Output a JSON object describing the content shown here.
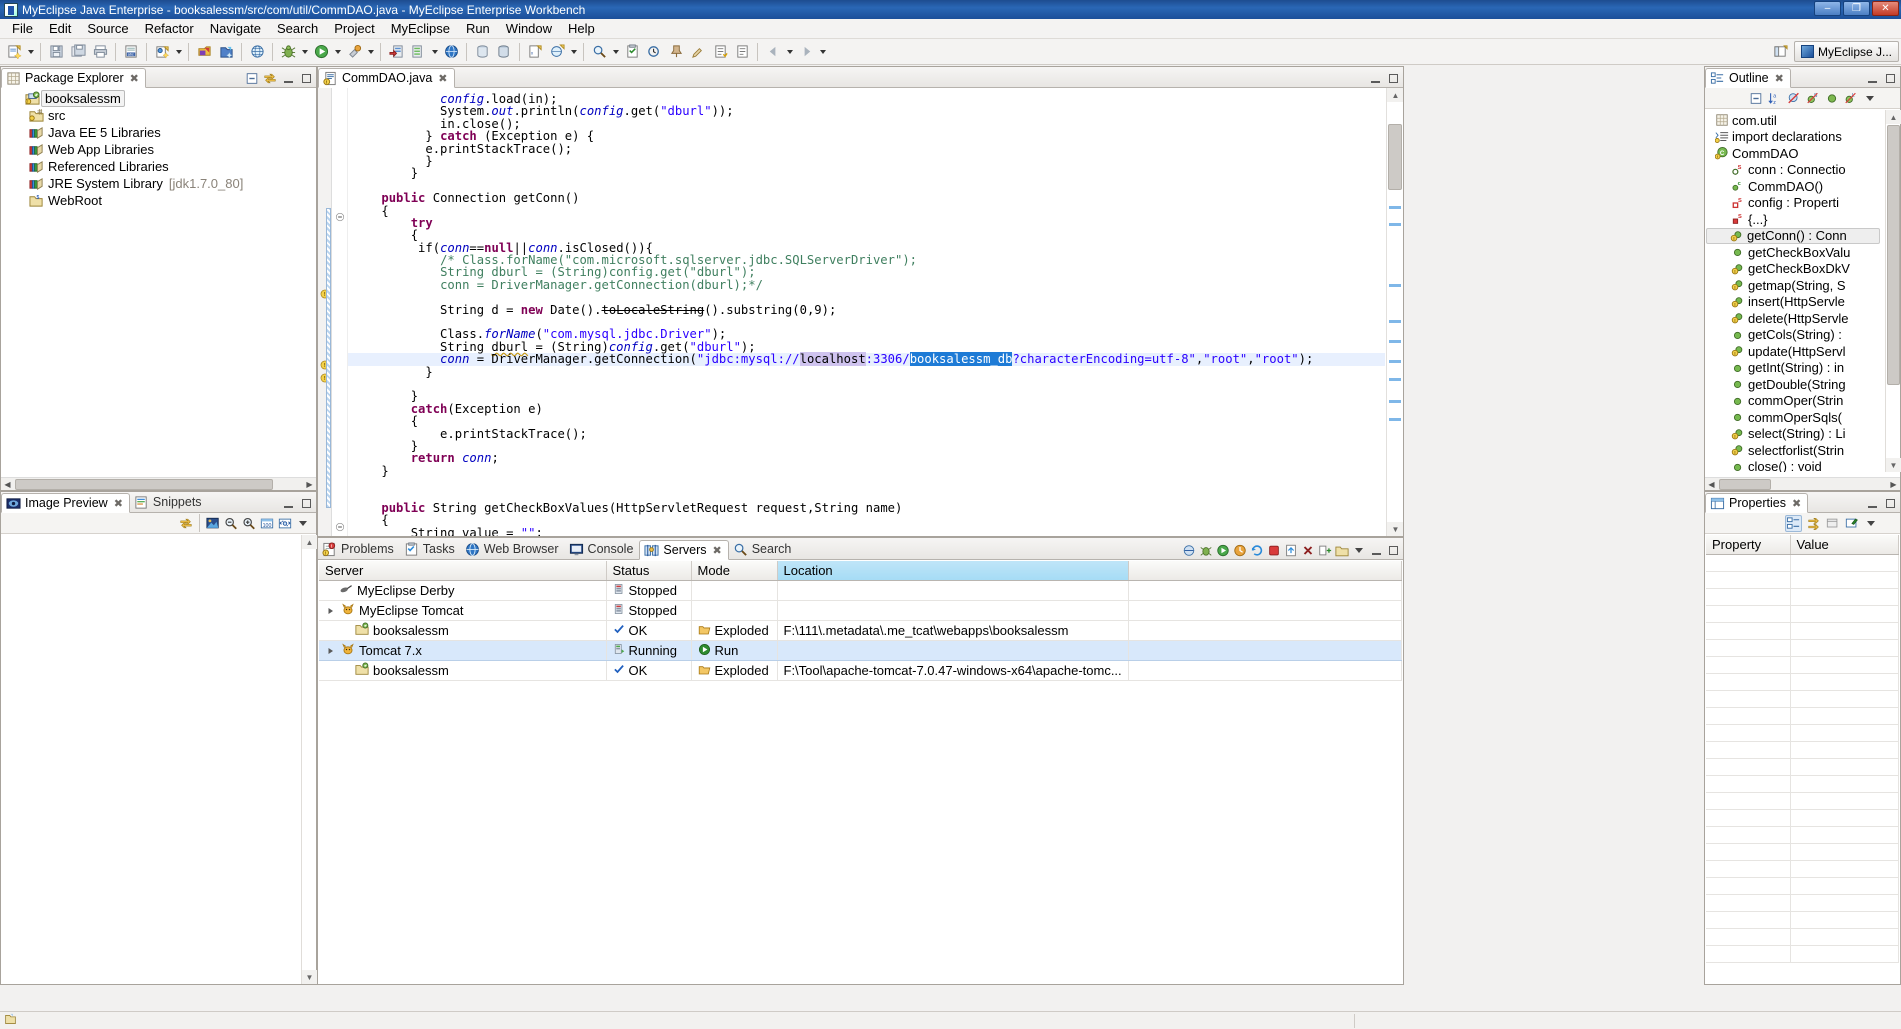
{
  "window": {
    "title": "MyEclipse Java Enterprise - booksalessm/src/com/util/CommDAO.java - MyEclipse Enterprise Workbench",
    "buttons": {
      "minimize": "–",
      "maximize": "❐",
      "close": "✕"
    }
  },
  "menubar": [
    "File",
    "Edit",
    "Source",
    "Refactor",
    "Navigate",
    "Search",
    "Project",
    "MyEclipse",
    "Run",
    "Window",
    "Help"
  ],
  "perspective": {
    "label": "MyEclipse J..."
  },
  "package_explorer": {
    "tab": "Package Explorer",
    "tree": [
      {
        "label": "booksalessm",
        "indent": 0,
        "icon": "project-icon",
        "selected": true
      },
      {
        "label": "src",
        "indent": 1,
        "icon": "source-folder-icon",
        "selected": false
      },
      {
        "label": "Java EE 5 Libraries",
        "indent": 1,
        "icon": "library-icon",
        "selected": false
      },
      {
        "label": "Web App Libraries",
        "indent": 1,
        "icon": "library-icon",
        "selected": false
      },
      {
        "label": "Referenced Libraries",
        "indent": 1,
        "icon": "library-icon",
        "selected": false
      },
      {
        "label": "JRE System Library",
        "suffix": "[jdk1.7.0_80]",
        "indent": 1,
        "icon": "library-icon",
        "selected": false
      },
      {
        "label": "WebRoot",
        "indent": 1,
        "icon": "webroot-folder-icon",
        "selected": false
      }
    ]
  },
  "image_preview": {
    "tabs": [
      {
        "label": "Image Preview",
        "active": true,
        "icon": "image-preview-icon"
      },
      {
        "label": "Snippets",
        "active": false,
        "icon": "snippets-icon"
      }
    ]
  },
  "editor": {
    "tab": {
      "label": "CommDAO.java",
      "icon": "java-warning-icon"
    },
    "lines": [
      {
        "html": "            <i>config</i>.load(in);"
      },
      {
        "html": "            System.<i>out</i>.println(<i>config</i>.get(<s>\"dburl\"</s>));"
      },
      {
        "html": "            in.close();"
      },
      {
        "html": "          } <k>catch</k> (Exception e) {"
      },
      {
        "html": "          e.printStackTrace();"
      },
      {
        "html": "          }"
      },
      {
        "html": "        }"
      },
      {
        "html": ""
      },
      {
        "html": "    <k>public</k> Connection getConn()"
      },
      {
        "html": "    {"
      },
      {
        "html": "        <k>try</k>"
      },
      {
        "html": "        {"
      },
      {
        "html": "         if(<i>conn</i>==<k>null</k>||<i>conn</i>.isClosed()){"
      },
      {
        "html": "            <c>/* Class.forName(\"com.microsoft.sqlserver.jdbc.SQLServerDriver\");</c>"
      },
      {
        "html": "            <c>String dburl = (String)config.get(\"dburl\");</c>"
      },
      {
        "html": "            <c>conn = DriverManager.getConnection(dburl);*/</c>"
      },
      {
        "html": ""
      },
      {
        "html": "            String d = <k>new</k> Date().<d>toLocaleString</d>().substring(0,9);"
      },
      {
        "html": ""
      },
      {
        "html": "            Class.<i>forName</i>(<s>\"com.mysql.jdbc.Driver\"</s>);"
      },
      {
        "html": "            String <u>dburl</u> = (String)<i>config</i>.get(<s>\"dburl\"</s>);"
      },
      {
        "html": "            <i>conn</i> = DriverManager.getConnection(<s>\"jdbc:mysql://</s><lilac>localhost</lilac><s>:3306/</s><blue>booksalessm_db</blue><s>?characterEncoding=utf-8\"</s>,<s>\"root\"</s>,<s>\"root\"</s>);",
        "highlight": true
      },
      {
        "html": "          }"
      },
      {
        "html": ""
      },
      {
        "html": "        }"
      },
      {
        "html": "        <k>catch</k>(Exception e)"
      },
      {
        "html": "        {"
      },
      {
        "html": "            e.printStackTrace();"
      },
      {
        "html": "        }"
      },
      {
        "html": "        <k>return</k> <i>conn</i>;"
      },
      {
        "html": "    }"
      },
      {
        "html": ""
      },
      {
        "html": ""
      },
      {
        "html": "    <k>public</k> String getCheckBoxValues(HttpServletRequest request,String name)"
      },
      {
        "html": "    {"
      },
      {
        "html": "        String value = <s>\"\"</s>;"
      }
    ],
    "selection": {
      "text": "booksalessm_db",
      "occurrence": "localhost"
    }
  },
  "outline": {
    "tab": "Outline",
    "items": [
      {
        "label": "com.util",
        "icon": "package-icon",
        "indent": 0,
        "selected": false
      },
      {
        "label": "import declarations",
        "icon": "imports-icon",
        "indent": 0,
        "selected": false
      },
      {
        "label": "CommDAO",
        "icon": "class-icon",
        "indent": 0,
        "selected": false
      },
      {
        "label": "conn : Connectio",
        "icon": "field-private-static-icon",
        "indent": 1,
        "selected": false,
        "type": "Connectio"
      },
      {
        "label": "CommDAO()",
        "icon": "constructor-icon",
        "indent": 1,
        "selected": false
      },
      {
        "label": "config : Properti",
        "icon": "field-static-icon",
        "indent": 1,
        "selected": false
      },
      {
        "label": "{...}",
        "icon": "static-initializer-icon",
        "indent": 1,
        "selected": false
      },
      {
        "label": "getConn() : Conn",
        "icon": "method-warning-icon",
        "indent": 1,
        "selected": true
      },
      {
        "label": "getCheckBoxValu",
        "icon": "method-icon",
        "indent": 1,
        "selected": false
      },
      {
        "label": "getCheckBoxDkV",
        "icon": "method-warning-icon",
        "indent": 1,
        "selected": false
      },
      {
        "label": "getmap(String, S",
        "icon": "method-warning-icon",
        "indent": 1,
        "selected": false
      },
      {
        "label": "insert(HttpServle",
        "icon": "method-warning-icon",
        "indent": 1,
        "selected": false
      },
      {
        "label": "delete(HttpServle",
        "icon": "method-warning-icon",
        "indent": 1,
        "selected": false
      },
      {
        "label": "getCols(String) :",
        "icon": "method-icon",
        "indent": 1,
        "selected": false
      },
      {
        "label": "update(HttpServl",
        "icon": "method-warning-icon",
        "indent": 1,
        "selected": false
      },
      {
        "label": "getInt(String) : in",
        "icon": "method-icon",
        "indent": 1,
        "selected": false
      },
      {
        "label": "getDouble(String",
        "icon": "method-icon",
        "indent": 1,
        "selected": false
      },
      {
        "label": "commOper(Strin",
        "icon": "method-icon",
        "indent": 1,
        "selected": false
      },
      {
        "label": "commOperSqls(",
        "icon": "method-icon",
        "indent": 1,
        "selected": false
      },
      {
        "label": "select(String) : Li",
        "icon": "method-warning-icon",
        "indent": 1,
        "selected": false
      },
      {
        "label": "selectforlist(Strin",
        "icon": "method-warning-icon",
        "indent": 1,
        "selected": false
      },
      {
        "label": "close() : void",
        "icon": "method-icon",
        "indent": 1,
        "selected": false
      }
    ]
  },
  "properties": {
    "tab": "Properties",
    "columns": [
      "Property",
      "Value"
    ]
  },
  "bottom_panel": {
    "tabs": [
      {
        "label": "Problems",
        "active": false,
        "icon": "problems-icon"
      },
      {
        "label": "Tasks",
        "active": false,
        "icon": "tasks-icon"
      },
      {
        "label": "Web Browser",
        "active": false,
        "icon": "web-browser-icon"
      },
      {
        "label": "Console",
        "active": false,
        "icon": "console-icon"
      },
      {
        "label": "Servers",
        "active": true,
        "icon": "servers-icon"
      },
      {
        "label": "Search",
        "active": false,
        "icon": "search-icon"
      }
    ],
    "servers_table": {
      "columns": [
        "Server",
        "Status",
        "Mode",
        "Location"
      ],
      "highlighted_column": "Location",
      "rows": [
        {
          "server": "MyEclipse Derby",
          "status": "Stopped",
          "mode": "",
          "location": "",
          "indent": 1,
          "icon": "derby-icon",
          "status_icon": "stopped-icon",
          "expander": "",
          "selected": false
        },
        {
          "server": "MyEclipse Tomcat",
          "status": "Stopped",
          "mode": "",
          "location": "",
          "indent": 1,
          "icon": "tomcat-icon",
          "status_icon": "stopped-icon",
          "expander": "collapsed",
          "selected": false
        },
        {
          "server": "booksalessm",
          "status": "OK",
          "mode": "Exploded",
          "location": "F:\\111\\.metadata\\.me_tcat\\webapps\\booksalessm",
          "indent": 2,
          "icon": "module-icon",
          "status_icon": "ok-icon",
          "mode_icon": "exploded-icon",
          "expander": "",
          "selected": false
        },
        {
          "server": "Tomcat  7.x",
          "status": "Running",
          "mode": "Run",
          "location": "",
          "indent": 1,
          "icon": "tomcat-icon",
          "status_icon": "running-icon",
          "mode_icon": "run-icon",
          "expander": "collapsed",
          "selected": true
        },
        {
          "server": "booksalessm",
          "status": "OK",
          "mode": "Exploded",
          "location": "F:\\Tool\\apache-tomcat-7.0.47-windows-x64\\apache-tomc...",
          "indent": 2,
          "icon": "module-icon",
          "status_icon": "ok-icon",
          "mode_icon": "exploded-icon",
          "expander": "",
          "selected": false
        }
      ]
    }
  },
  "colors": {
    "title_bar": "#1d4c8f",
    "selection_blue": "#1e7bd6",
    "occurrence_lilac": "#cfc3ef",
    "row_selected": "#d8e8fb",
    "column_highlight": "#a6dcf5",
    "keyword": "#7f0055",
    "string": "#2a00ff",
    "comment": "#3f7f5f",
    "field": "#0000c0"
  }
}
